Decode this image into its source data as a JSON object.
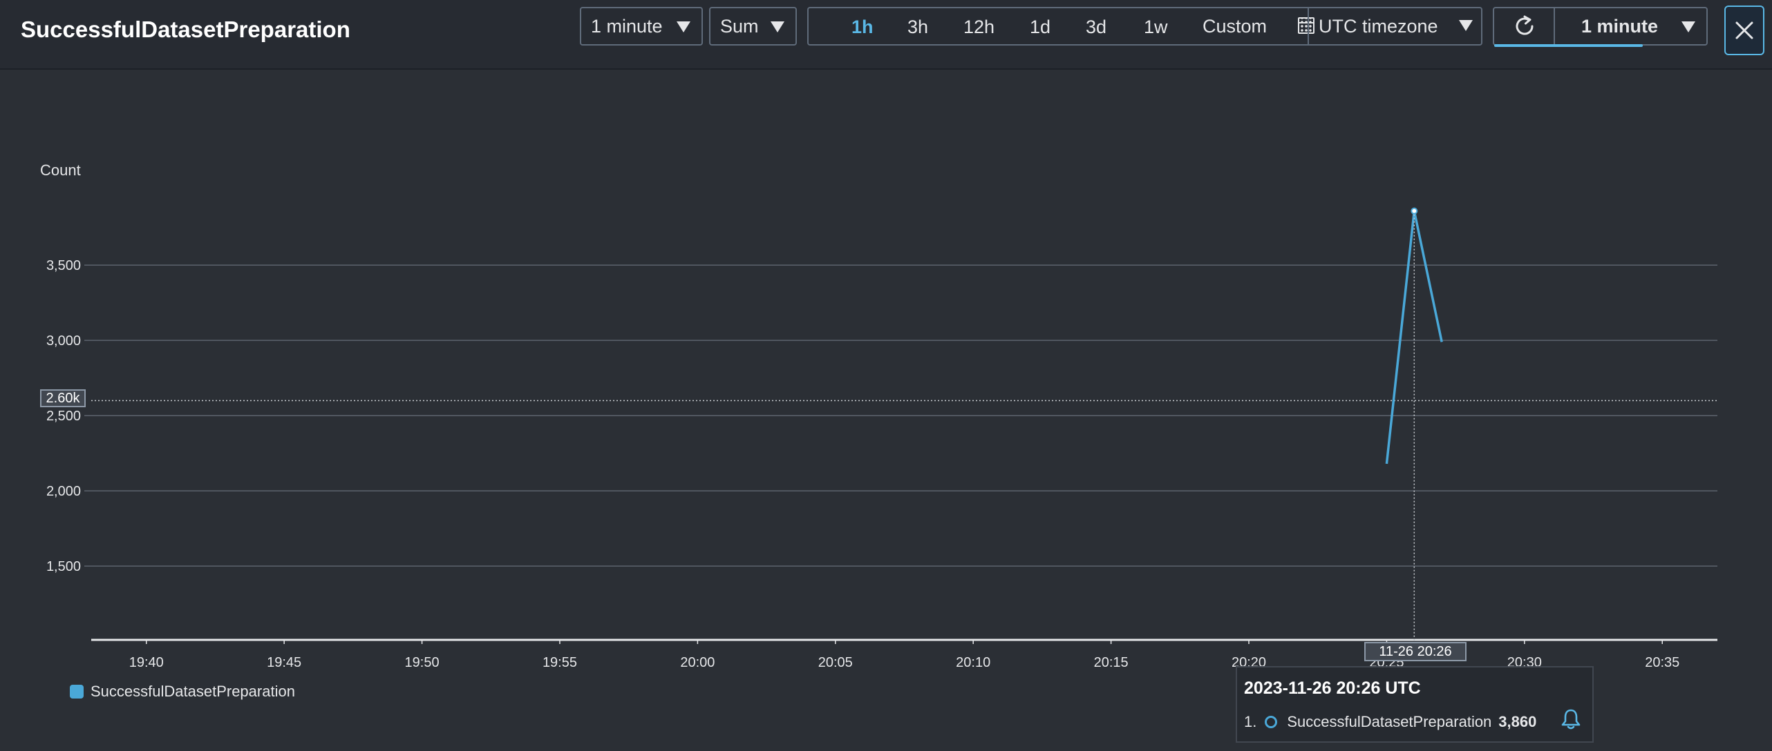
{
  "header": {
    "title": "SuccessfulDatasetPreparation",
    "period_select": "1 minute",
    "stat_select": "Sum",
    "time_ranges": [
      "1h",
      "3h",
      "12h",
      "1d",
      "3d",
      "1w"
    ],
    "active_range": "1h",
    "custom_label": "Custom",
    "timezone_select": "UTC timezone",
    "refresh_interval": "1 minute",
    "refresh_progress": 0.7
  },
  "chart": {
    "ylabel": "Count",
    "crosshair_y_label": "2.60k",
    "hover_x_label": "11-26 20:26",
    "legend_label": "SuccessfulDatasetPreparation"
  },
  "tooltip": {
    "title": "2023-11-26 20:26 UTC",
    "index": "1.",
    "series_name": "SuccessfulDatasetPreparation",
    "value": "3,860"
  },
  "colors": {
    "series": "#4aa8d8",
    "accent": "#5ab8e6",
    "background": "#2b2f35"
  },
  "icons": [
    "chevron-down-icon",
    "calendar-icon",
    "refresh-icon",
    "close-icon",
    "bell-icon"
  ],
  "chart_data": {
    "type": "line",
    "ylabel": "Count",
    "y_ticks": [
      1500,
      2000,
      2500,
      3000,
      3500
    ],
    "y_tick_labels": [
      "1,500",
      "2,000",
      "2,500",
      "3,000",
      "3,500"
    ],
    "x_ticks": [
      "19:40",
      "19:45",
      "19:50",
      "19:55",
      "20:00",
      "20:05",
      "20:10",
      "20:15",
      "20:20",
      "20:25",
      "20:30",
      "20:35"
    ],
    "ylim": [
      1010,
      4230
    ],
    "xlim_minutes": [
      "19:38",
      "20:37"
    ],
    "grid": true,
    "legend_position": "bottom-left",
    "series": [
      {
        "name": "SuccessfulDatasetPreparation",
        "x": [
          "20:25",
          "20:26",
          "20:27"
        ],
        "y": [
          2180,
          3860,
          2990
        ]
      }
    ]
  }
}
